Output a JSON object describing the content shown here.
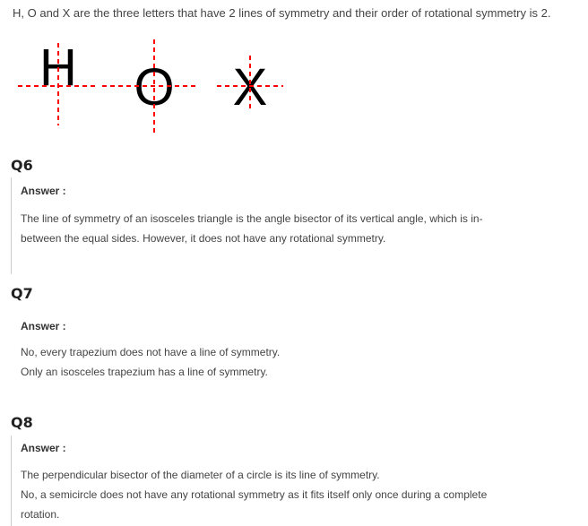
{
  "intro": {
    "text": "H, O and X are the three letters that have 2 lines of symmetry and their order of rotational symmetry is 2."
  },
  "figure": {
    "letters": [
      "H",
      "O",
      "X"
    ],
    "line_color": "#ff0000"
  },
  "questions": [
    {
      "heading": "Q6",
      "answer_label": "Answer :",
      "lines": [
        "The line of symmetry of an isosceles triangle is the angle bisector of its vertical angle, which is in-",
        "between the equal sides. However, it does not have any rotational symmetry."
      ]
    },
    {
      "heading": "Q7",
      "answer_label": "Answer :",
      "lines": [
        "No, every trapezium does not have a line of symmetry.",
        "Only an isosceles trapezium has a line of symmetry."
      ]
    },
    {
      "heading": "Q8",
      "answer_label": "Answer :",
      "lines": [
        "The perpendicular bisector of the diameter of a circle is its line of symmetry.",
        "No, a semicircle does not have any rotational symmetry as it fits itself only once during a complete",
        "rotation."
      ]
    }
  ]
}
